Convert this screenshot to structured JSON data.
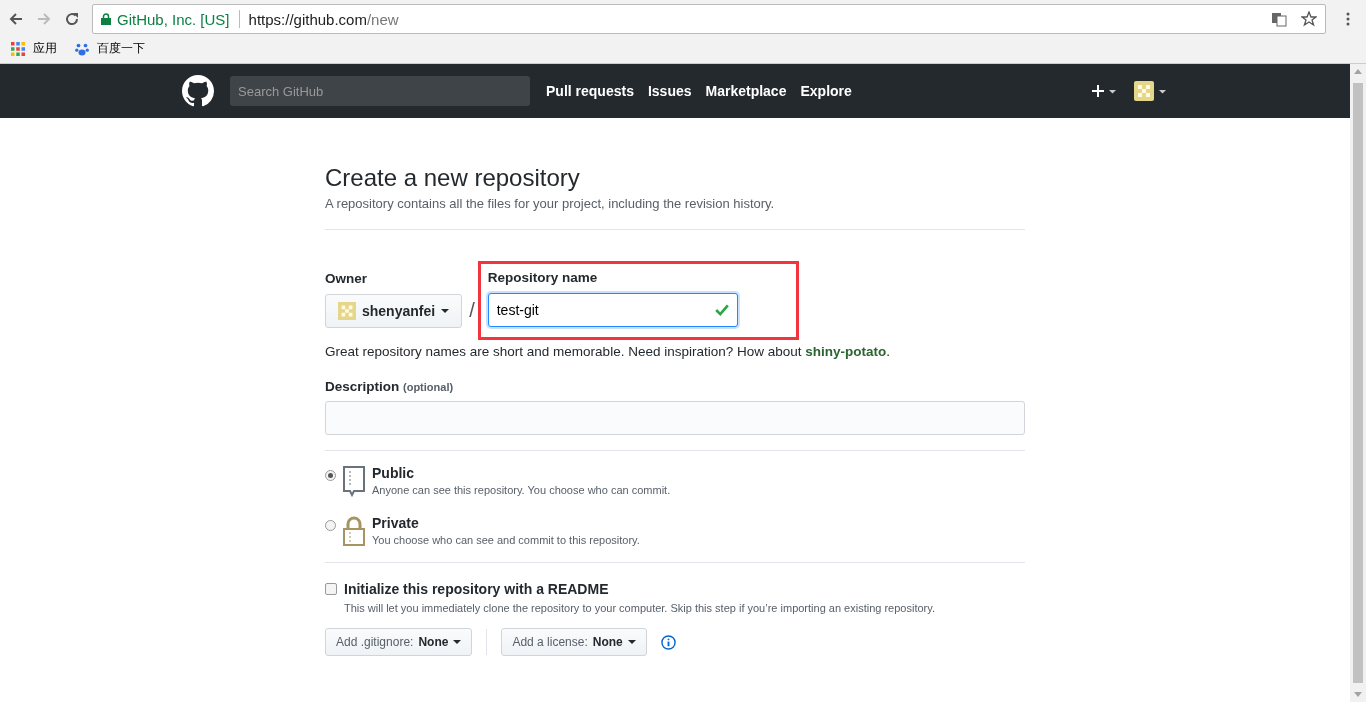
{
  "browser": {
    "site_identity": "GitHub, Inc. [US]",
    "url_host": "https://github.com",
    "url_path": "/new",
    "bookmarks": [
      "应用",
      "百度一下"
    ]
  },
  "header": {
    "search": {
      "placeholder": "Search GitHub"
    },
    "links": [
      "Pull requests",
      "Issues",
      "Marketplace",
      "Explore"
    ]
  },
  "form": {
    "title": "Create a new repository",
    "subtitle": "A repository contains all the files for your project, including the revision history.",
    "owner": {
      "label": "Owner",
      "value": "shenyanfei"
    },
    "repo_name": {
      "label": "Repository name",
      "value": "test-git",
      "valid": true,
      "highlighted": true
    },
    "separator": "/",
    "hint": {
      "text": "Great repository names are short and memorable. Need inspiration? How about",
      "suggestion": "shiny-potato",
      "end": "."
    },
    "description": {
      "label": "Description",
      "note": "(optional)"
    },
    "visibility": [
      {
        "kind": "public",
        "label": "Public",
        "detail": "Anyone can see this repository. You choose who can commit.",
        "selected": true
      },
      {
        "kind": "private",
        "label": "Private",
        "detail": "You choose who can see and commit to this repository.",
        "selected": false
      }
    ],
    "readme": {
      "label": "Initialize this repository with a README",
      "detail": "This will let you immediately clone the repository to your computer. Skip this step if you’re importing an existing repository.",
      "checked": false
    },
    "dropdowns": [
      {
        "label": "Add .gitignore:",
        "value": "None"
      },
      {
        "label": "Add a license:",
        "value": "None"
      }
    ]
  }
}
